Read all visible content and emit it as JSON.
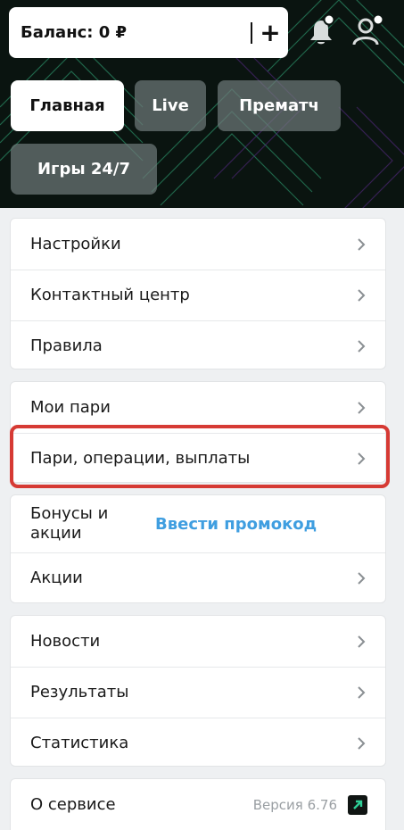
{
  "header": {
    "balance_label": "Баланс: 0 ₽",
    "add_label": "+",
    "icons": [
      "bell-icon",
      "user-icon"
    ],
    "accent": "#2ecf97"
  },
  "nav": {
    "tabs": [
      {
        "label": "Главная",
        "active": true
      },
      {
        "label": "Live",
        "active": false
      },
      {
        "label": "Прематч",
        "active": false
      },
      {
        "label": "Игры 24/7",
        "active": false
      }
    ]
  },
  "menu": {
    "group1": [
      "Настройки",
      "Контактный центр",
      "Правила"
    ],
    "group2": [
      "Мои пари",
      "Пари, операции, выплаты"
    ],
    "group3": {
      "bonuses_label": "Бонусы и акции",
      "promo_link": "Ввести промокод",
      "promos_label": "Акции"
    },
    "group4": [
      "Новости",
      "Результаты",
      "Статистика"
    ],
    "about": {
      "label": "О сервисе",
      "version": "Версия 6.76"
    }
  },
  "colors": {
    "highlight": "#d63a34",
    "link": "#3f9ee0"
  }
}
